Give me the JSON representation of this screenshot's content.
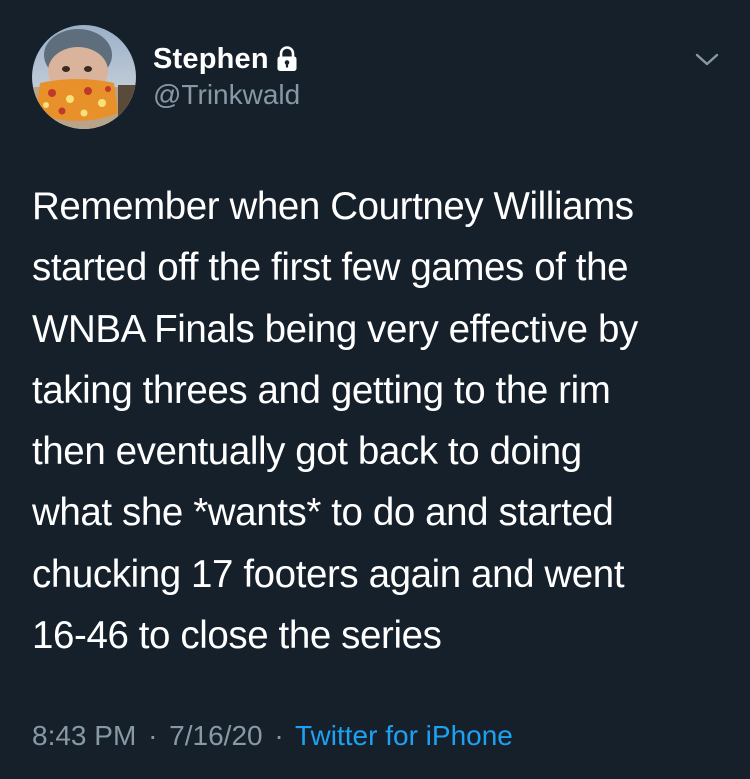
{
  "user": {
    "display_name": "Stephen",
    "handle": "@Trinkwald",
    "protected_icon": "lock-icon",
    "avatar_icon": "avatar-photo"
  },
  "menu": {
    "icon": "chevron-down-icon"
  },
  "tweet": {
    "text": "Remember when Courtney Williams\nstarted off the first few games of the\nWNBA Finals being very effective by\ntaking threes and getting to the rim\nthen eventually got back to doing\nwhat she *wants* to do and started\nchucking 17 footers again and went\n16-46 to close the series",
    "time": "8:43 PM",
    "date": "7/16/20",
    "separator": "·",
    "source": "Twitter for iPhone"
  },
  "colors": {
    "background": "#15202b",
    "text": "#ffffff",
    "secondary_text": "#8899a6",
    "link": "#1da1f2"
  }
}
